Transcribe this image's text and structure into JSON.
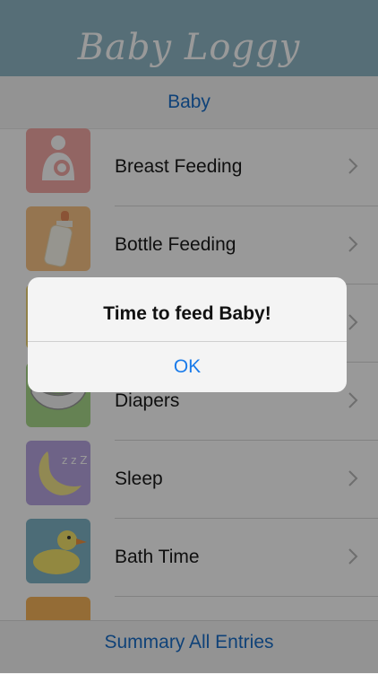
{
  "header": {
    "logo_text": "Baby Loggy"
  },
  "subbar": {
    "title": "Baby"
  },
  "list": {
    "items": [
      {
        "label": "Breast Feeding",
        "icon": "breast-feeding-icon",
        "tile_color": "#f3a9a6"
      },
      {
        "label": "Bottle Feeding",
        "icon": "bottle-icon",
        "tile_color": "#f8c486"
      },
      {
        "label": "",
        "icon": "hidden-row-icon",
        "tile_color": "#f2d778"
      },
      {
        "label": "Diapers",
        "icon": "diaper-icon",
        "tile_color": "#a9d98b"
      },
      {
        "label": "Sleep",
        "icon": "moon-icon",
        "tile_color": "#b7a5e2"
      },
      {
        "label": "Bath Time",
        "icon": "duck-icon",
        "tile_color": "#7fb5c7"
      },
      {
        "label": "",
        "icon": "partial-row-icon",
        "tile_color": "#f7b55b"
      }
    ]
  },
  "footer": {
    "link_label": "Summary All Entries"
  },
  "alert": {
    "message": "Time to feed Baby!",
    "ok_label": "OK"
  },
  "colors": {
    "header_bg": "#8fb8c7",
    "link_blue": "#1a6ec9"
  }
}
